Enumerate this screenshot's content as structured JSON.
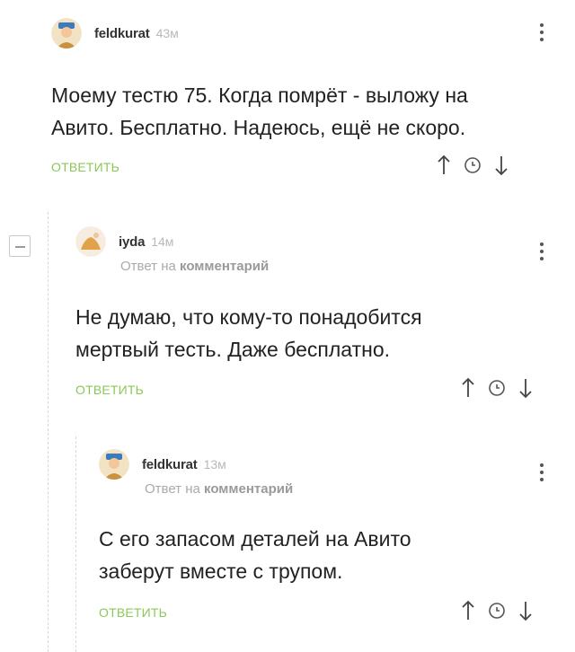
{
  "comments": [
    {
      "user": "feldkurat",
      "time": "43м",
      "reply_to": null,
      "lines": [
        "Моему тестю 75. Когда помрёт - выложу на",
        "Авито. Бесплатно. Надеюсь, ещё не скоро."
      ],
      "reply_label": "ОТВЕТИТЬ"
    },
    {
      "user": "iyda",
      "time": "14м",
      "reply_to": {
        "prefix": "Ответ на",
        "link": "комментарий"
      },
      "lines": [
        "Не думаю, что кому-то понадобится",
        "мертвый тесть. Даже бесплатно."
      ],
      "reply_label": "ОТВЕТИТЬ"
    },
    {
      "user": "feldkurat",
      "time": "13м",
      "reply_to": {
        "prefix": "Ответ на",
        "link": "комментарий"
      },
      "lines": [
        "С его запасом деталей на Авито",
        "заберут вместе с трупом."
      ],
      "reply_label": "ОТВЕТИТЬ"
    }
  ],
  "icons": {
    "up": "arrow-up-icon",
    "history": "clock-icon",
    "down": "arrow-down-icon",
    "menu": "more-vertical-icon",
    "collapse": "minus-icon"
  },
  "colors": {
    "reply": "#8ac858",
    "time": "#b9b9b9",
    "text": "#222222"
  }
}
